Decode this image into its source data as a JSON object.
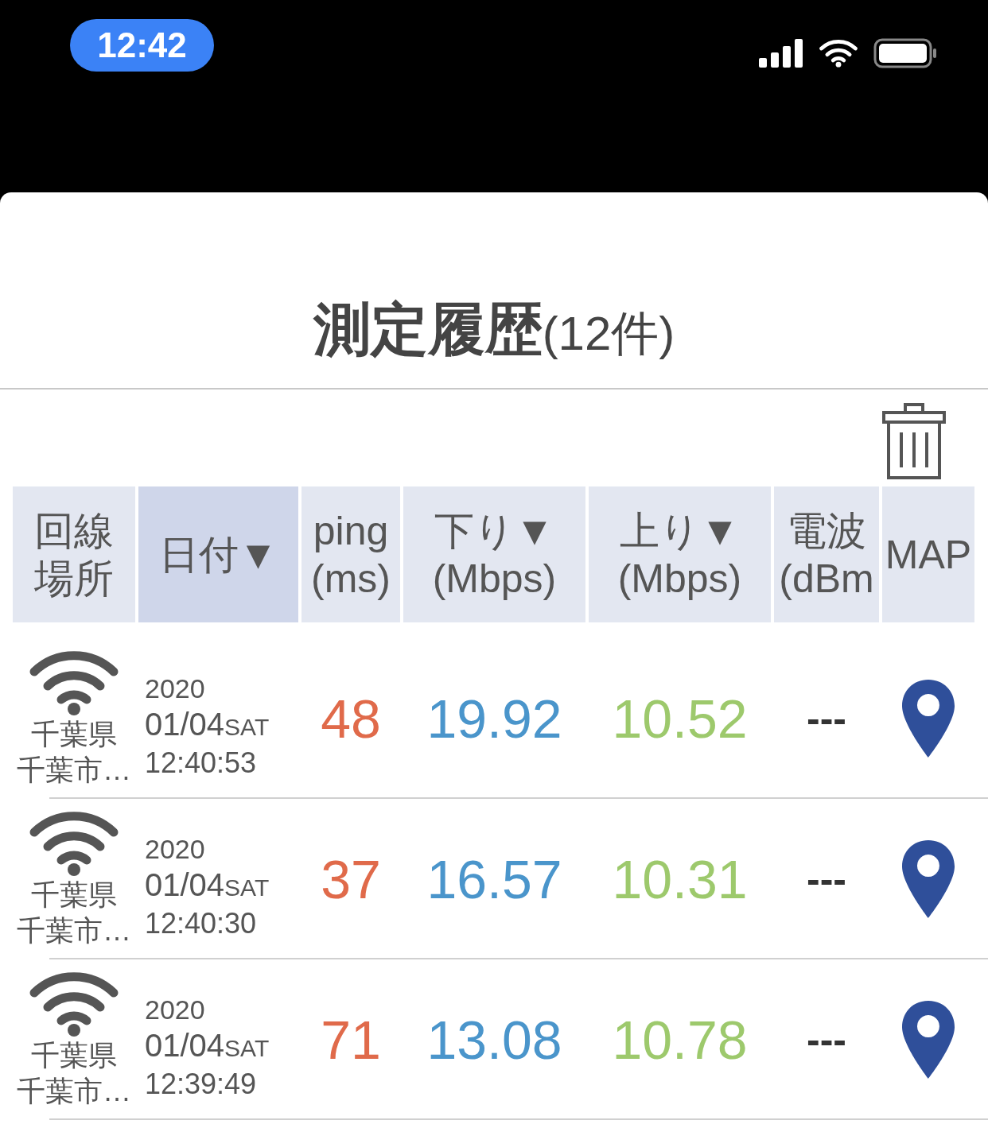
{
  "status_bar": {
    "time": "12:42"
  },
  "title": {
    "text": "測定履歴",
    "count": "(12件)"
  },
  "table": {
    "columns": [
      {
        "lines": [
          "回線",
          "場所"
        ],
        "selected": false
      },
      {
        "lines": [
          "日付▼"
        ],
        "selected": true
      },
      {
        "lines": [
          "ping",
          "(ms)"
        ],
        "selected": false
      },
      {
        "lines": [
          "下り▼",
          "(Mbps)"
        ],
        "selected": false
      },
      {
        "lines": [
          "上り▼",
          "(Mbps)"
        ],
        "selected": false
      },
      {
        "lines": [
          "電波",
          "(dBm"
        ],
        "selected": false
      },
      {
        "lines": [
          "MAP"
        ],
        "selected": false
      }
    ],
    "rows": [
      {
        "location": [
          "千葉県",
          "千葉市…"
        ],
        "year": "2020",
        "date": "01/04",
        "weekday": "SAT",
        "time": "12:40:53",
        "ping": "48",
        "down": "19.92",
        "up": "10.52",
        "signal": "---"
      },
      {
        "location": [
          "千葉県",
          "千葉市…"
        ],
        "year": "2020",
        "date": "01/04",
        "weekday": "SAT",
        "time": "12:40:30",
        "ping": "37",
        "down": "16.57",
        "up": "10.31",
        "signal": "---"
      },
      {
        "location": [
          "千葉県",
          "千葉市…"
        ],
        "year": "2020",
        "date": "01/04",
        "weekday": "SAT",
        "time": "12:39:49",
        "ping": "71",
        "down": "13.08",
        "up": "10.78",
        "signal": "---"
      }
    ]
  }
}
